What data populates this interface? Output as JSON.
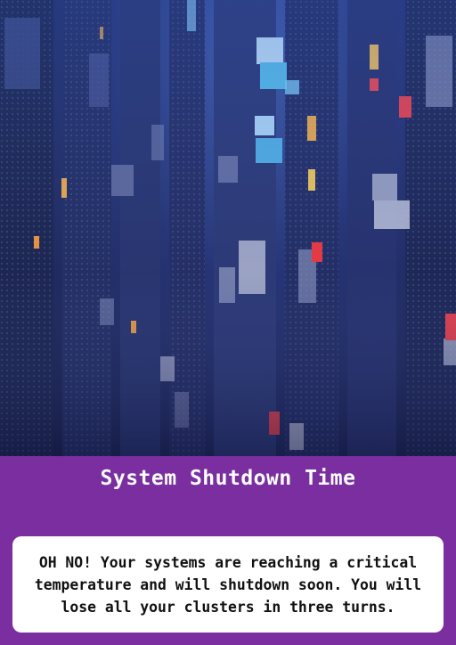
{
  "card": {
    "title": "System Shutdown Time",
    "description": "OH NO! Your systems are reaching a critical temperature and will shutdown soon. You will lose all your clusters in three turns.",
    "image_subject": "cyberpunk-server-towers-art",
    "colors": {
      "panel": "#7a2ea0",
      "text_box": "#ffffff",
      "title_text": "#ffffff",
      "body_text": "#111111"
    }
  }
}
